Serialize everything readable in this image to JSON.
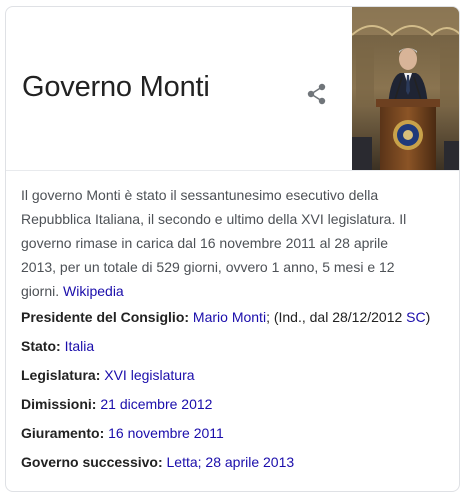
{
  "card": {
    "title": "Governo Monti",
    "share_icon": "share-icon",
    "image": "podium-photo"
  },
  "description": {
    "text": "Il governo Monti è stato il sessantunesimo esecutivo della Repubblica Italiana, il secondo e ultimo della XVI legislatura. Il governo rimase in carica dal 16 novembre 2011 al 28 aprile 2013, per un totale di 529 giorni, ovvero 1 anno, 5 mesi e 12 giorni.",
    "source_link": "Wikipedia"
  },
  "facts": [
    {
      "label": "Presidente del Consiglio:",
      "parts": [
        {
          "text": "Mario Monti",
          "link": true
        },
        {
          "text": "; (Ind., dal 28/12/2012 ",
          "link": false
        },
        {
          "text": "SC",
          "link": true
        },
        {
          "text": ")",
          "link": false
        }
      ]
    },
    {
      "label": "Stato:",
      "parts": [
        {
          "text": "Italia",
          "link": true
        }
      ]
    },
    {
      "label": "Legislatura:",
      "parts": [
        {
          "text": "XVI legislatura",
          "link": true
        }
      ]
    },
    {
      "label": "Dimissioni:",
      "parts": [
        {
          "text": "21 dicembre 2012",
          "link": true
        }
      ]
    },
    {
      "label": "Giuramento:",
      "parts": [
        {
          "text": "16 novembre 2011",
          "link": true
        }
      ]
    },
    {
      "label": "Governo successivo:",
      "parts": [
        {
          "text": "Letta; 28 aprile 2013",
          "link": true
        }
      ]
    }
  ],
  "colors": {
    "link": "#1a0dab",
    "text": "#222222",
    "description": "#4d5156",
    "border": "#dfe1e5"
  }
}
